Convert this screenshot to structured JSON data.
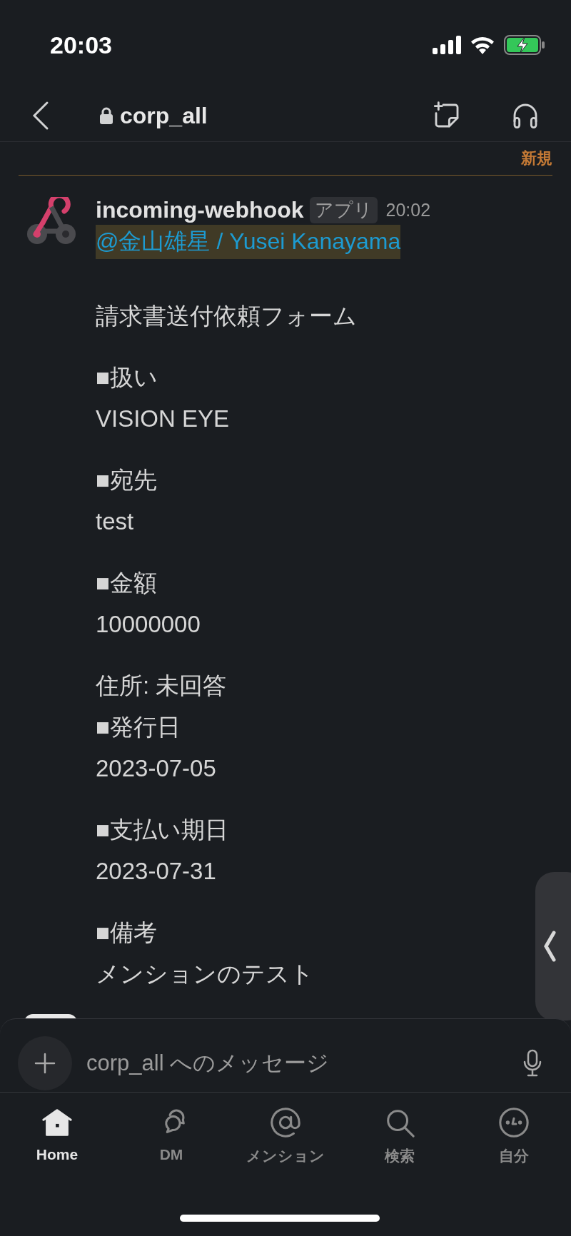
{
  "status_bar": {
    "time": "20:03"
  },
  "header": {
    "channel": "corp_all",
    "private": true
  },
  "new_divider": {
    "label": "新規"
  },
  "message": {
    "sender": "incoming-webhook",
    "badge": "アプリ",
    "time": "20:02",
    "mention": "@金山雄星 / Yusei Kanayama",
    "paragraphs": [
      [
        "請求書送付依頼フォーム"
      ],
      [
        "■扱い",
        "VISION EYE"
      ],
      [
        "■宛先",
        "test"
      ],
      [
        "■金額",
        "10000000"
      ],
      [
        "住所: 未回答",
        "■発行日",
        "2023-07-05"
      ],
      [
        "■支払い期日",
        "2023-07-31"
      ],
      [
        "■備考",
        "メンションのテスト"
      ]
    ]
  },
  "composer": {
    "placeholder": "corp_all へのメッセージ"
  },
  "tabs": [
    {
      "label": "Home",
      "selected": true
    },
    {
      "label": "DM",
      "selected": false
    },
    {
      "label": "メンション",
      "selected": false
    },
    {
      "label": "検索",
      "selected": false
    },
    {
      "label": "自分",
      "selected": false
    }
  ]
}
